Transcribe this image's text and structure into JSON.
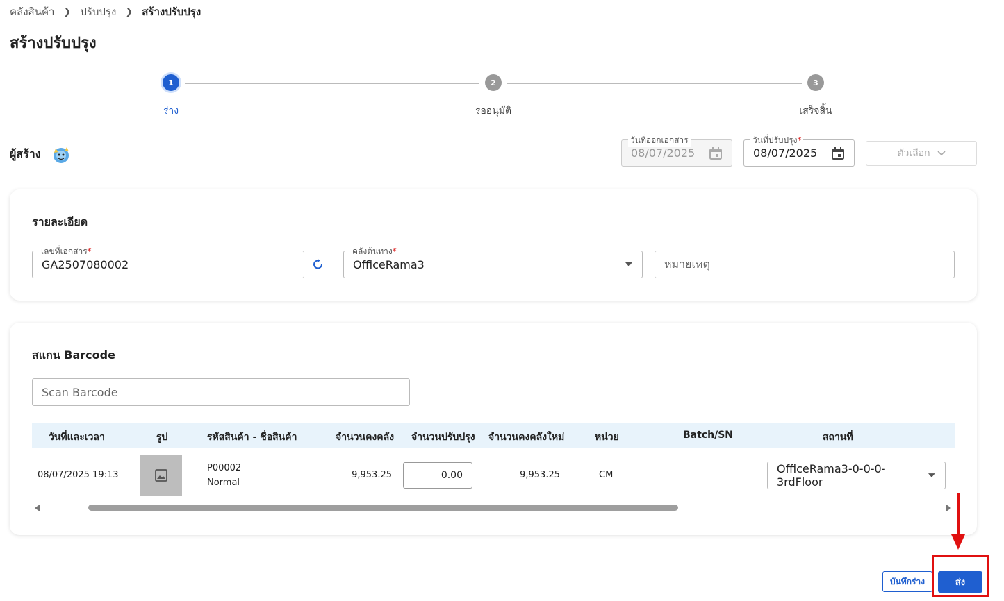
{
  "breadcrumb": [
    "คลังสินค้า",
    "ปรับปรุง",
    "สร้างปรับปรุง"
  ],
  "page_title": "สร้างปรับปรุง",
  "stepper": [
    {
      "num": "1",
      "label": "ร่าง",
      "active": true
    },
    {
      "num": "2",
      "label": "รออนุมัติ",
      "active": false
    },
    {
      "num": "3",
      "label": "เสร็จสิ้น",
      "active": false
    }
  ],
  "creator_label": "ผู้สร้าง",
  "issue_date": {
    "label": "วันที่ออกเอกสาร",
    "value": "08/07/2025"
  },
  "adjust_date": {
    "label": "วันที่ปรับปรุง",
    "required": "*",
    "value": "08/07/2025"
  },
  "options_button": "ตัวเลือก",
  "details": {
    "title": "รายละเอียด",
    "doc_no_label": "เลขที่เอกสาร",
    "doc_no": "GA2507080002",
    "warehouse_label": "คลังต้นทาง",
    "warehouse": "OfficeRama3",
    "note_placeholder": "หมายเหตุ",
    "required": "*"
  },
  "scan": {
    "title": "สแกน Barcode",
    "placeholder": "Scan Barcode"
  },
  "table": {
    "headers": [
      "วันที่และเวลา",
      "รูป",
      "รหัสสินค้า - ชื่อสินค้า",
      "จำนวนคงคลัง",
      "จำนวนปรับปรุง",
      "จำนวนคงคลังใหม่",
      "หน่วย",
      "Batch/SN",
      "สถานที่"
    ],
    "rows": [
      {
        "datetime": "08/07/2025 19:13",
        "code": "P00002",
        "name": "Normal",
        "stock": "9,953.25",
        "adjust": "0.00",
        "new_stock": "9,953.25",
        "unit": "CM",
        "batch": "",
        "location": "OfficeRama3-0-0-0-3rdFloor"
      }
    ]
  },
  "footer": {
    "draft_button": "บันทึกร่าง",
    "send_button": "ส่ง"
  },
  "colors": {
    "primary": "#1f5fd0",
    "annotation": "#e01010"
  }
}
